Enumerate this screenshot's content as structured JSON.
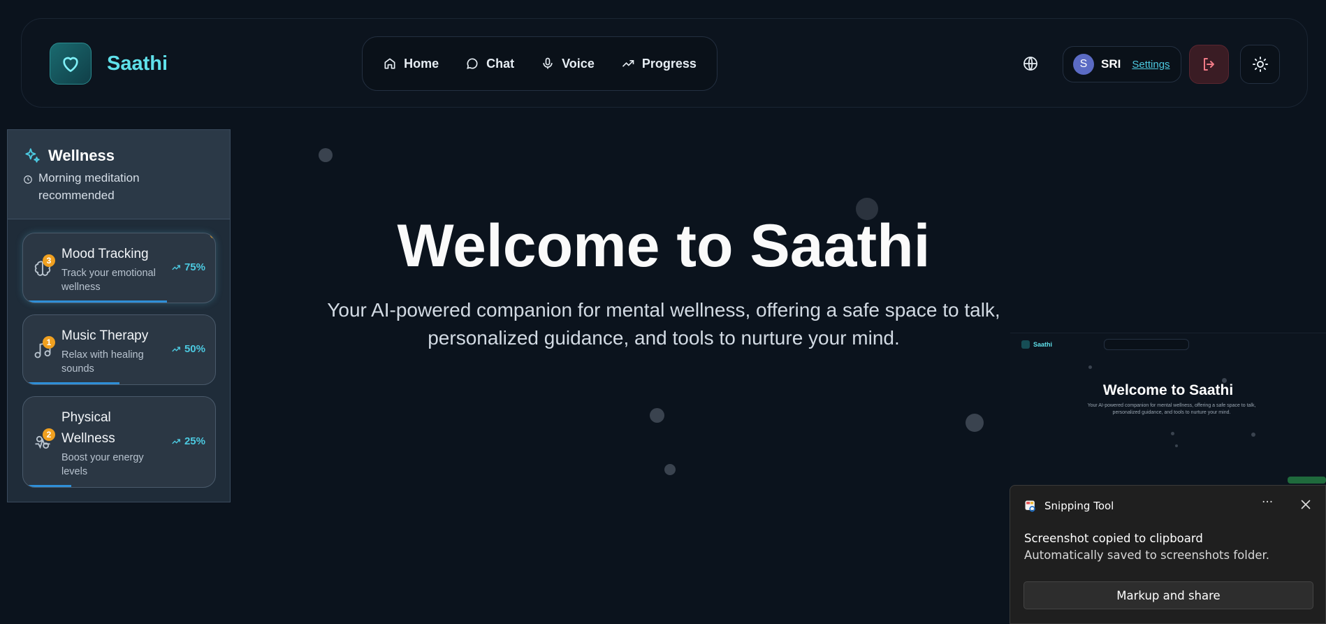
{
  "header": {
    "brand_name": "Saathi",
    "nav": [
      {
        "label": "Home",
        "icon": "home-icon"
      },
      {
        "label": "Chat",
        "icon": "chat-icon"
      },
      {
        "label": "Voice",
        "icon": "mic-icon"
      },
      {
        "label": "Progress",
        "icon": "trending-up-icon"
      }
    ],
    "user": {
      "initial": "S",
      "name": "SRI",
      "settings_label": "Settings"
    }
  },
  "sidebar": {
    "title": "Wellness",
    "subtitle": "Morning meditation recommended",
    "cards": [
      {
        "title": "Mood Tracking",
        "description": "Track your emotional wellness",
        "badge": "3",
        "percent_label": "75%",
        "progress": 0.75,
        "icon": "brain-icon"
      },
      {
        "title": "Music Therapy",
        "description": "Relax with healing sounds",
        "badge": "1",
        "percent_label": "50%",
        "progress": 0.5,
        "icon": "music-note-icon"
      },
      {
        "title": "Physical Wellness",
        "description": "Boost your energy levels",
        "badge": "2",
        "percent_label": "25%",
        "progress": 0.25,
        "icon": "activity-icon"
      }
    ]
  },
  "hero": {
    "title": "Welcome to Saathi",
    "subtitle": "Your AI-powered companion for mental wellness, offering a safe space to talk, personalized guidance, and tools to nurture your mind."
  },
  "thumbnail": {
    "brand_name": "Saathi",
    "title": "Welcome to Saathi",
    "subtitle": "Your AI-powered companion for mental wellness, offering a safe space to talk, personalized guidance, and tools to nurture your mind."
  },
  "toast": {
    "app_name": "Snipping Tool",
    "line1": "Screenshot copied to clipboard",
    "line2": "Automatically saved to screenshots folder.",
    "button_label": "Markup and share",
    "more_label": "···"
  },
  "colors": {
    "background": "#0b131d",
    "accent": "#5fe0ea",
    "link": "#4cc9e0",
    "badge": "#f0a020",
    "logout": "#3a1c24"
  }
}
